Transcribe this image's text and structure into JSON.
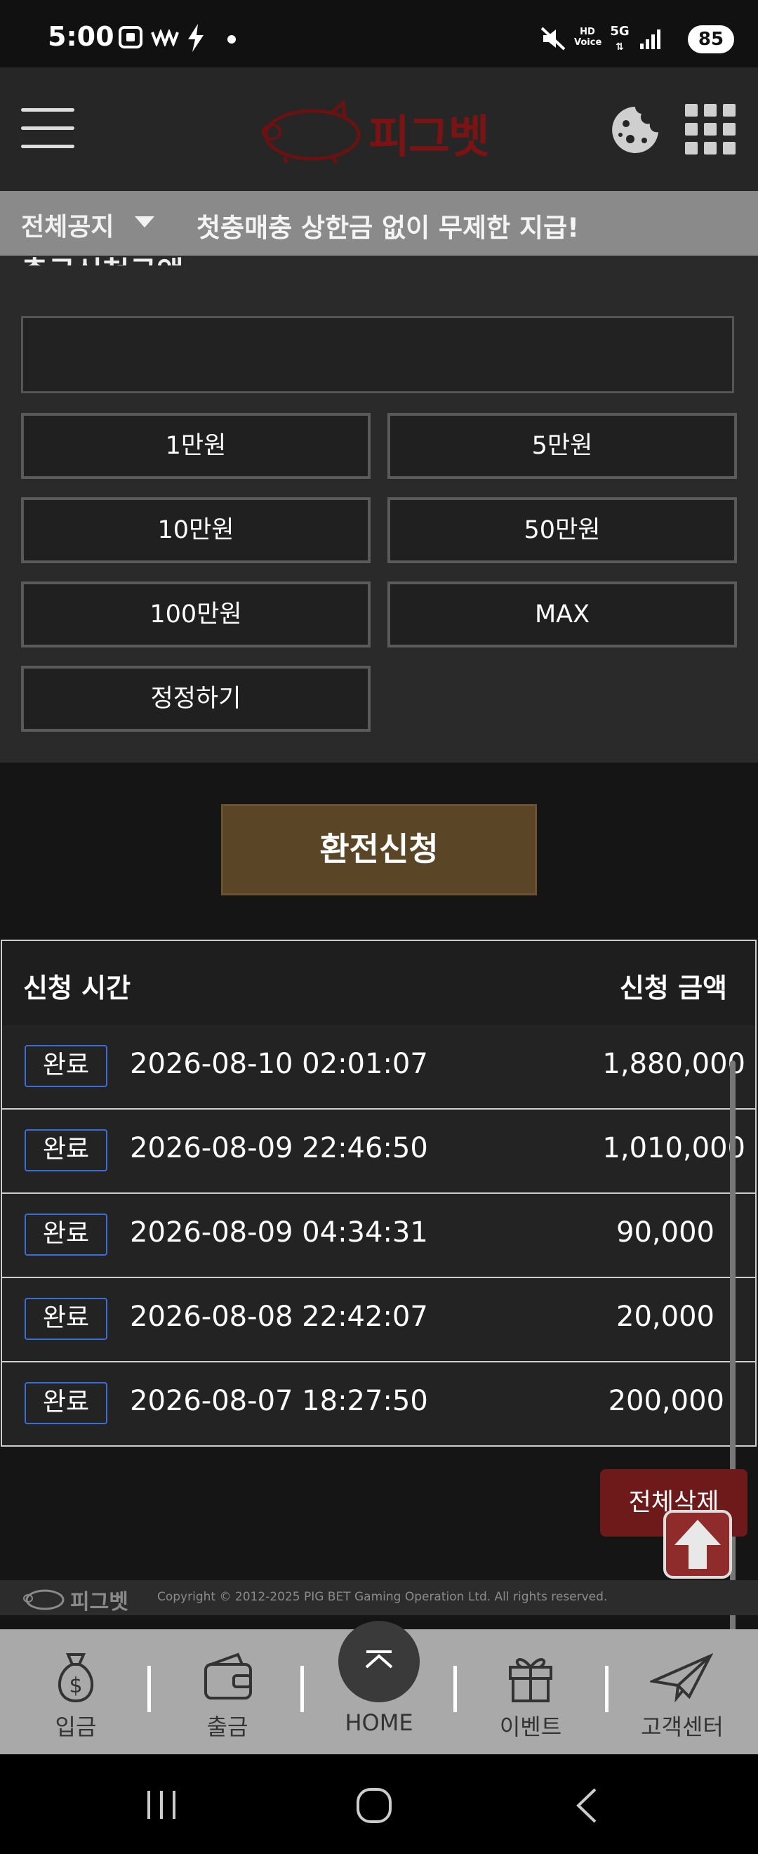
{
  "status_bar": {
    "time": "5:00",
    "battery": "85",
    "icons": [
      "screenshot-icon",
      "wave-icon",
      "charging-icon",
      "dot-icon",
      "mute-icon",
      "hd-voice-icon",
      "5g-icon",
      "signal-icon",
      "battery-icon"
    ]
  },
  "header": {
    "logo_text": "피그벳",
    "icons": [
      "menu-icon",
      "pig-logo",
      "cookie-icon",
      "grid-menu-icon"
    ]
  },
  "notice": {
    "label": "전체공지",
    "message": "첫충매충 상한금 없이 무제한 지급!"
  },
  "form": {
    "partial_title": "출금신청금액",
    "amount_input_value": "",
    "amount_buttons": [
      "1만원",
      "5만원",
      "10만원",
      "50만원",
      "100만원",
      "MAX"
    ],
    "reset_label": "정정하기",
    "submit_label": "환전신청"
  },
  "history": {
    "col_time": "신청 시간",
    "col_amount": "신청 금액",
    "rows": [
      {
        "status": "완료",
        "datetime": "2026-08-10 02:01:07",
        "amount": "1,880,000"
      },
      {
        "status": "완료",
        "datetime": "2026-08-09 22:46:50",
        "amount": "1,010,000"
      },
      {
        "status": "완료",
        "datetime": "2026-08-09 04:34:31",
        "amount": "90,000"
      },
      {
        "status": "완료",
        "datetime": "2026-08-08 22:42:07",
        "amount": "20,000"
      },
      {
        "status": "완료",
        "datetime": "2026-08-07 18:27:50",
        "amount": "200,000"
      }
    ],
    "delete_all_label": "전체삭제"
  },
  "footer": {
    "logo": "피그벳",
    "copyright": "Copyright © 2012-2025 PIG BET Gaming Operation Ltd. All rights reserved."
  },
  "bottom_nav": {
    "items": [
      {
        "label": "입금",
        "icon": "money-bag-icon"
      },
      {
        "label": "출금",
        "icon": "wallet-icon"
      },
      {
        "label": "HOME",
        "icon": "home-icon"
      },
      {
        "label": "이벤트",
        "icon": "gift-icon"
      },
      {
        "label": "고객센터",
        "icon": "paper-plane-icon"
      }
    ]
  },
  "colors": {
    "background": "#151515",
    "panel": "#2a2a2a",
    "notice_bar": "#8a8a8a",
    "submit_button": "#5a4526",
    "badge_border": "#3c6cd6",
    "delete_button": "#6e1a1a",
    "bottom_nav": "#a9a9a9",
    "logo_red": "#7a1414"
  }
}
